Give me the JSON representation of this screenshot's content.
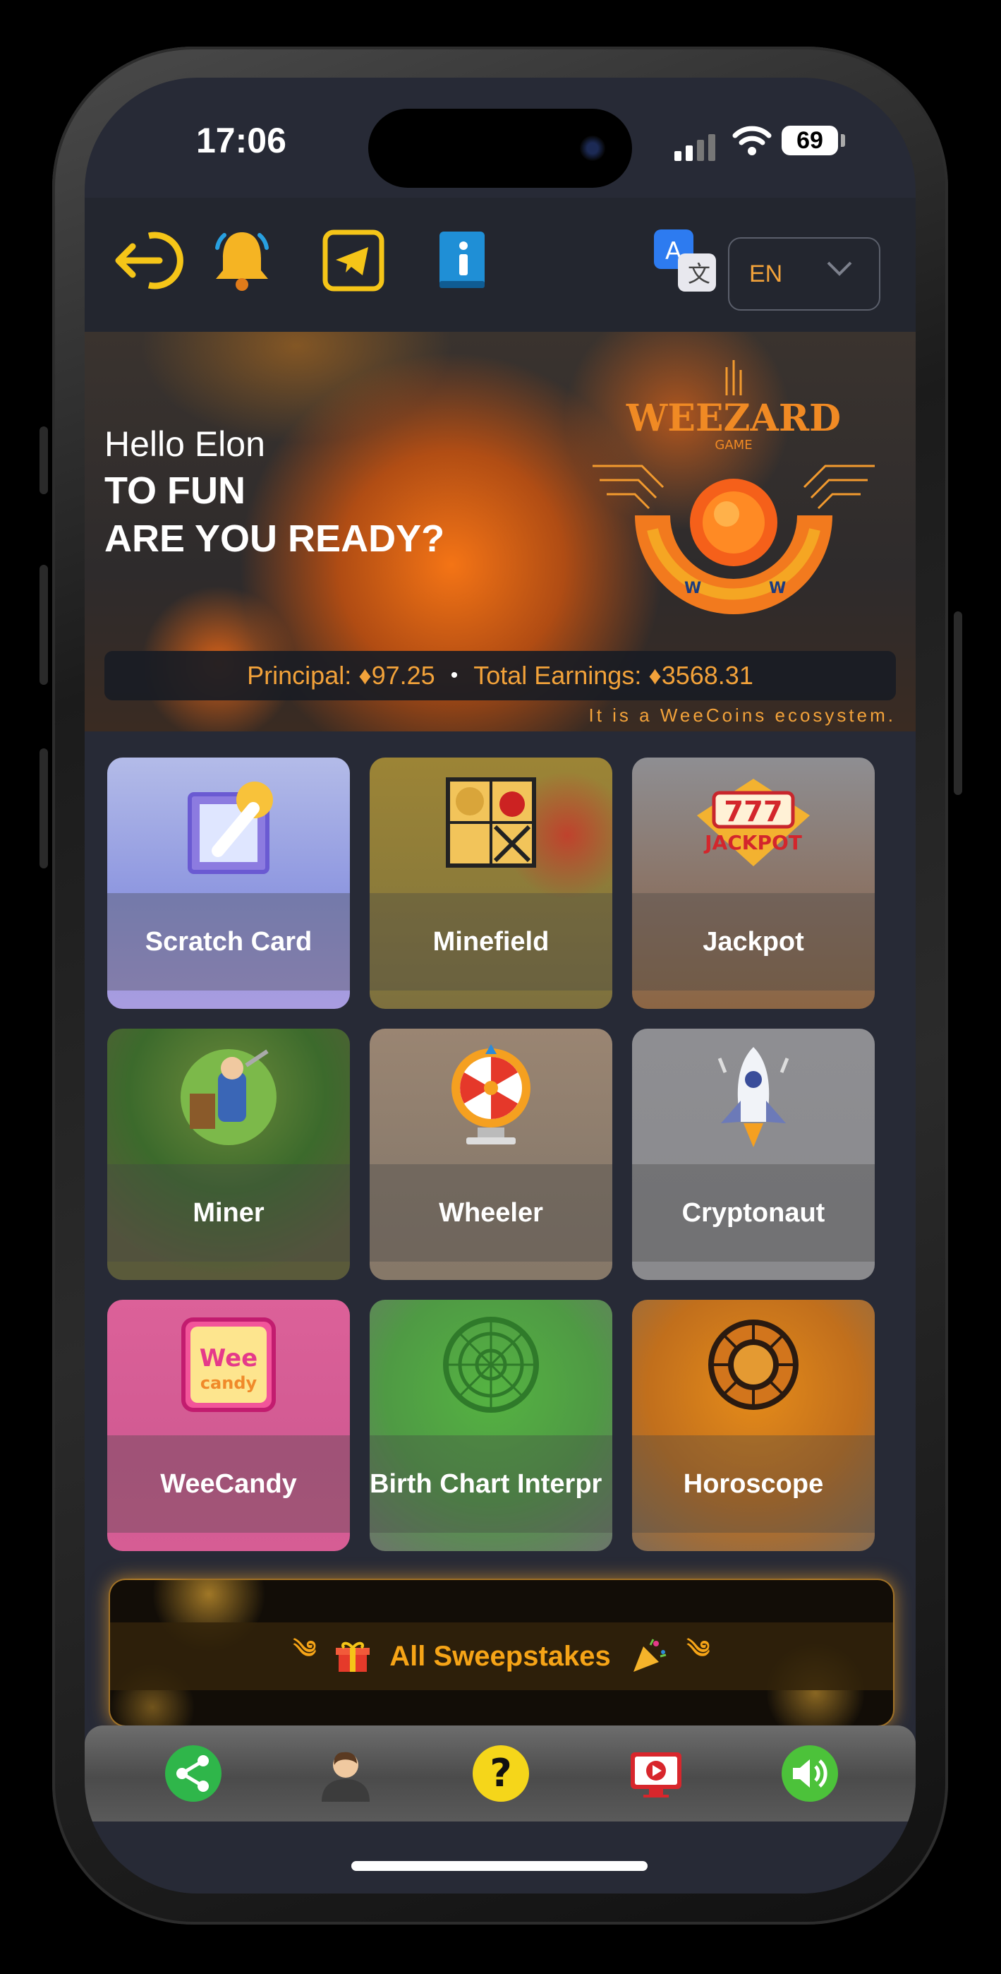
{
  "status_bar": {
    "time": "17:06",
    "battery": "69"
  },
  "toolbar": {
    "icons": [
      "logout-icon",
      "bell-icon",
      "telegram-icon",
      "info-book-icon",
      "translate-icon"
    ],
    "language": {
      "selected": "EN"
    }
  },
  "hero": {
    "greeting": "Hello Elon",
    "line1": "TO FUN",
    "line2": "ARE YOU READY?",
    "logo_text": "WEEZARD",
    "logo_sub": "GAME",
    "principal": "Principal: ♦97.25",
    "separator": "•",
    "total_earnings": "Total Earnings: ♦3568.31",
    "ecosystem_note": "It is a WeeCoins ecosystem."
  },
  "games": [
    {
      "label": "Scratch Card",
      "icon": "scratch-card-icon",
      "bg": "#8d96d8"
    },
    {
      "label": "Minefield",
      "icon": "minefield-icon",
      "bg": "#8a7a3a"
    },
    {
      "label": "Jackpot",
      "icon": "jackpot-icon",
      "bg": "#7a6a52"
    },
    {
      "label": "Miner",
      "icon": "miner-icon",
      "bg": "#5a7040"
    },
    {
      "label": "Wheeler",
      "icon": "wheel-icon",
      "bg": "#8a7b6c"
    },
    {
      "label": "Cryptonaut",
      "icon": "rocket-icon",
      "bg": "#8a8a8d"
    },
    {
      "label": "WeeCandy",
      "icon": "candy-icon",
      "bg": "#d95f97"
    },
    {
      "label": "Birth Chart Interpr",
      "icon": "zodiac-wheel-icon",
      "bg": "#5f9a4f"
    },
    {
      "label": "Horoscope",
      "icon": "horoscope-icon",
      "bg": "#b46a1e"
    }
  ],
  "sweepstakes": {
    "label": "All Sweepstakes"
  },
  "bottom_nav": [
    {
      "icon": "share-icon"
    },
    {
      "icon": "profile-icon"
    },
    {
      "icon": "help-icon"
    },
    {
      "icon": "video-icon"
    },
    {
      "icon": "sound-icon"
    }
  ]
}
